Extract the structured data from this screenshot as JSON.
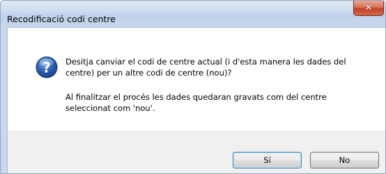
{
  "window": {
    "title": "Recodificació codi centre",
    "close_glyph": "✕"
  },
  "dialog": {
    "icon": "question-icon",
    "message_line1": "Desitja canviar el codi de centre actual (i d'esta manera les dades del centre) per un altre codi de centre (nou)?",
    "message_line2": "Al finalitzar el procés les dades quedaran gravats com del centre seleccionat com 'nou'."
  },
  "buttons": {
    "yes_label": "Sí",
    "no_label": "No"
  },
  "colors": {
    "titlebar": "#c7d7ec",
    "close_button": "#c4412a",
    "footer": "#f0f0f0",
    "icon_blue": "#2a5fb0"
  }
}
